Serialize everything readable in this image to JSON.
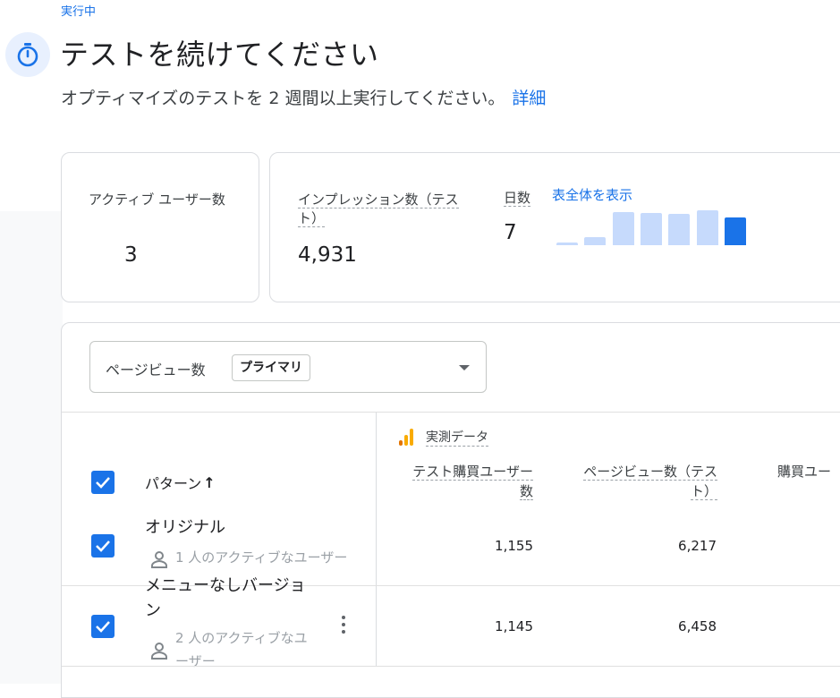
{
  "header": {
    "status": "実行中",
    "title": "テストを続けてください",
    "subtitle": "オプティマイズのテストを 2 週間以上実行してください。",
    "details_link": "詳細"
  },
  "metrics": {
    "active_users_label": "アクティブ ユーザー数",
    "active_users_value": "3",
    "impressions_label": "インプレッション数（テスト）",
    "impressions_value": "4,931",
    "days_label": "日数",
    "days_value": "7",
    "show_all_link": "表全体を表示",
    "daily_bars": [
      0.08,
      0.22,
      0.92,
      0.9,
      0.88,
      0.98,
      0.78
    ]
  },
  "metric_selector": {
    "label": "ページビュー数",
    "chip": "プライマリ"
  },
  "table": {
    "source_label": "実測データ",
    "pattern_header": "パターン",
    "sort_arrow": "↑",
    "columns": [
      "テスト購買ユーザー数",
      "ページビュー数（テスト）",
      "購買ユー"
    ],
    "rows": [
      {
        "name": "オリジナル",
        "users": "1 人のアクティブなユーザー",
        "purchase_users": "1,155",
        "pageviews": "6,217"
      },
      {
        "name": "メニューなしバージョン",
        "users": "2 人のアクティブなユーザー",
        "purchase_users": "1,145",
        "pageviews": "6,458"
      }
    ]
  },
  "colors": {
    "accent": "#1a73e8",
    "bar_light": "#c6dafc",
    "analytics_orange": "#f9ab00",
    "analytics_dark_orange": "#e37400"
  }
}
